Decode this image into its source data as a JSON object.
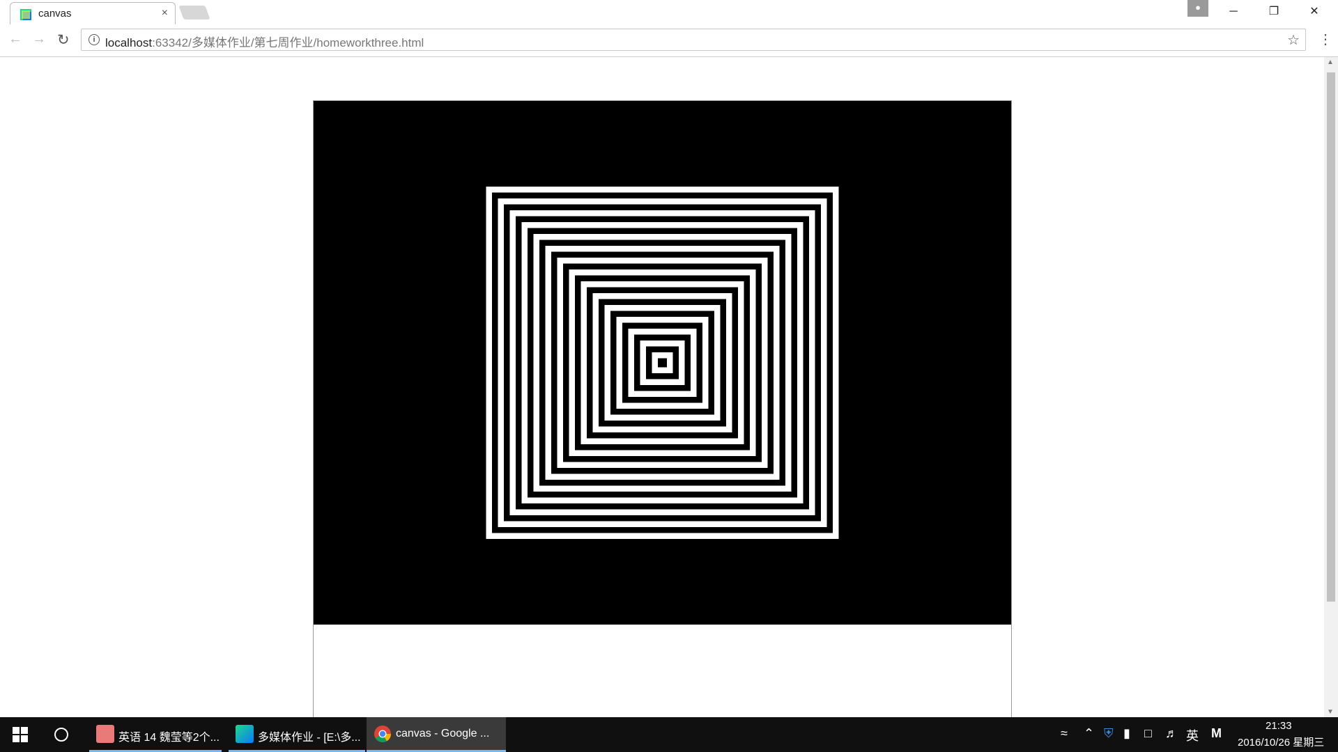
{
  "browser": {
    "tab_title": "canvas",
    "tab_close": "×",
    "url_host": "localhost",
    "url_rest": ":63342/多媒体作业/第七周作业/homeworkthree.html",
    "window_minimize": "─",
    "window_restore": "❐",
    "window_close": "✕"
  },
  "drawing": {
    "background": "#000000",
    "stripe_color": "#ffffff",
    "shape": "concentric-squares"
  },
  "taskbar": {
    "tasks": [
      {
        "label": "英语 14 魏莹等2个..."
      },
      {
        "label": "多媒体作业 - [E:\\多..."
      },
      {
        "label": "canvas - Google ..."
      }
    ],
    "ime": "英",
    "clock_time": "21:33",
    "clock_date": "2016/10/26 星期三"
  },
  "colors": {
    "taskbar_bg": "#101010",
    "active_accent": "#76b9ed"
  }
}
